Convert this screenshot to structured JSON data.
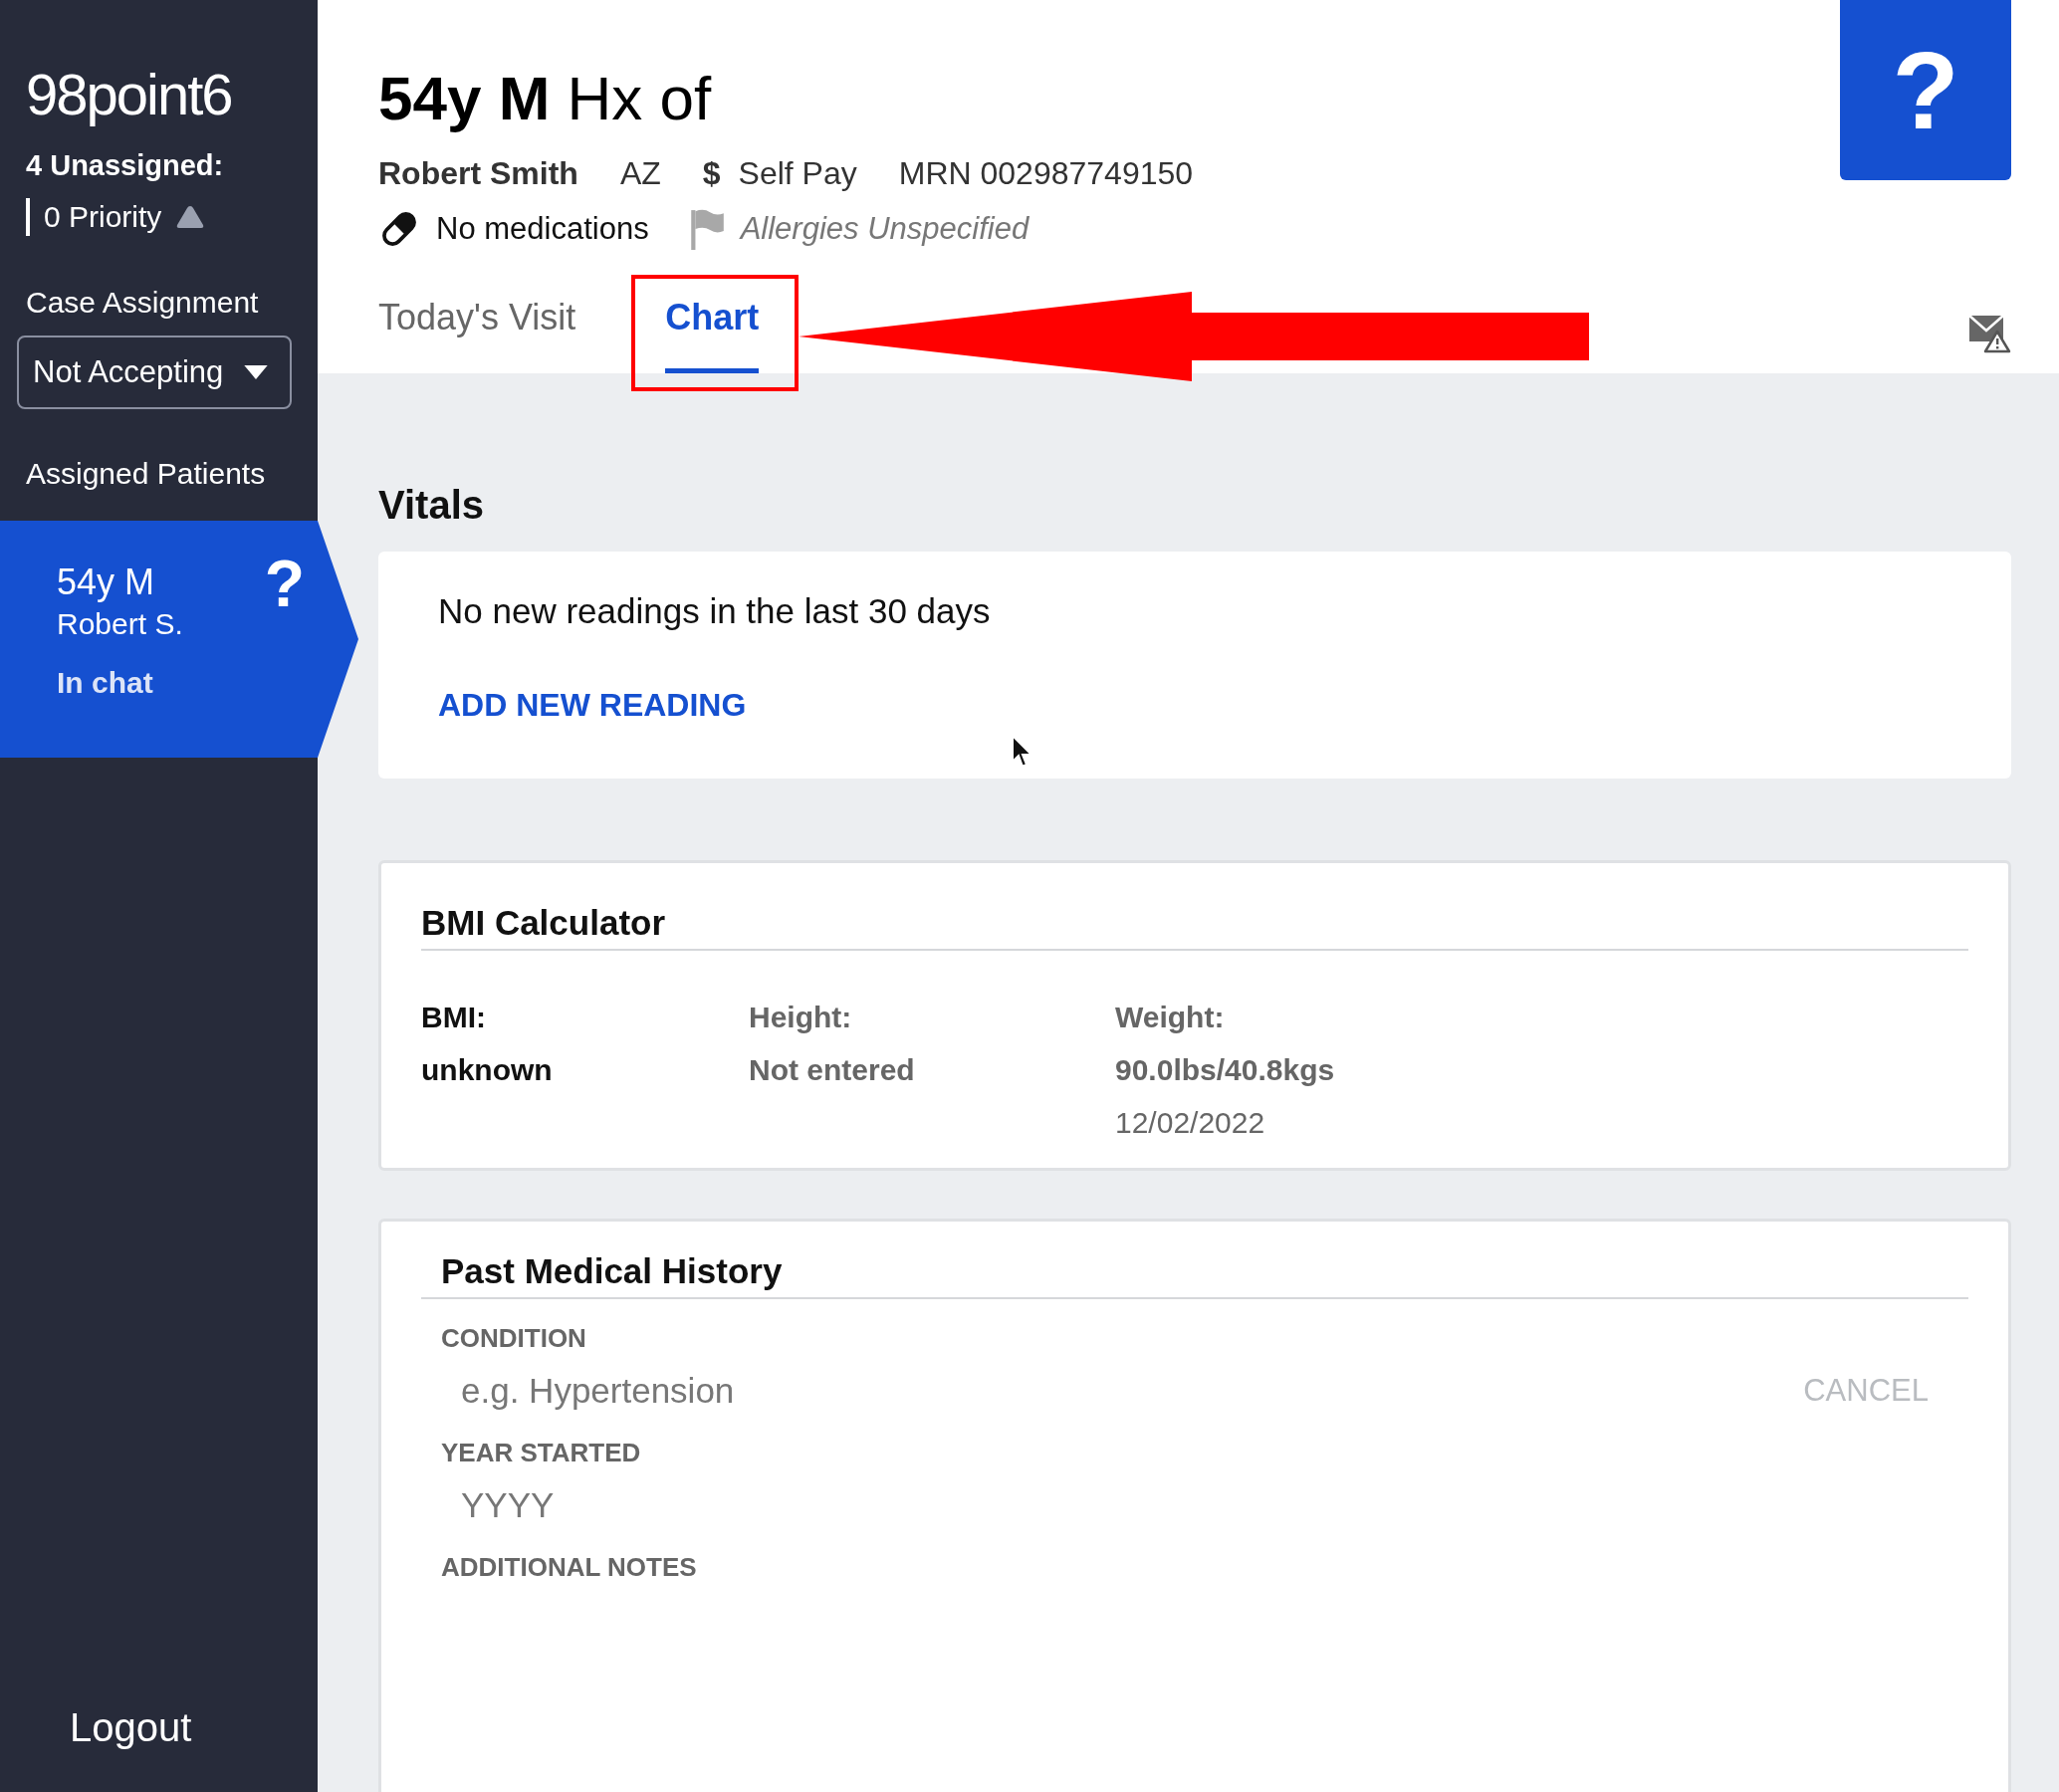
{
  "sidebar": {
    "logo": "98point6",
    "unassigned": "4 Unassigned:",
    "priority": "0 Priority",
    "case_assignment": {
      "label": "Case Assignment",
      "value": "Not Accepting"
    },
    "assigned_heading": "Assigned Patients",
    "patients": [
      {
        "title": "54y M",
        "name": "Robert S.",
        "status": "In chat",
        "badge": "?",
        "selected": true
      }
    ],
    "logout": "Logout"
  },
  "header": {
    "title": "**54y M** Hx of",
    "name": "Robert Smith",
    "state": "AZ",
    "payment_icon": "$",
    "payment": "Self Pay",
    "mrn": "MRN 002987749150",
    "medications": "No medications",
    "allergies": "Allergies Unspecified",
    "help": "?"
  },
  "tabs": [
    {
      "label": "Today's Visit",
      "selected": false
    },
    {
      "label": "Chart",
      "selected": true
    }
  ],
  "vitals": {
    "heading": "Vitals",
    "message": "No new readings in the last 30 days",
    "action": "ADD NEW READING"
  },
  "bmi": {
    "heading": "BMI Calculator",
    "columns": [
      {
        "label": "BMI:",
        "lines": [
          "unknown"
        ],
        "kind": "dark"
      },
      {
        "label": "Height:",
        "lines": [
          "Not entered"
        ],
        "kind": "muted"
      },
      {
        "label": "Weight:",
        "lines": [
          "90.0lbs/40.8kgs",
          "12/02/2022"
        ],
        "kind": "muted"
      }
    ]
  },
  "history": {
    "heading": "Past Medical History",
    "condition_label": "CONDITION",
    "condition_placeholder": "e.g. Hypertension",
    "cancel": "CANCEL",
    "year_label": "YEAR STARTED",
    "year_placeholder": "YYYY",
    "notes_label": "ADDITIONAL NOTES"
  }
}
